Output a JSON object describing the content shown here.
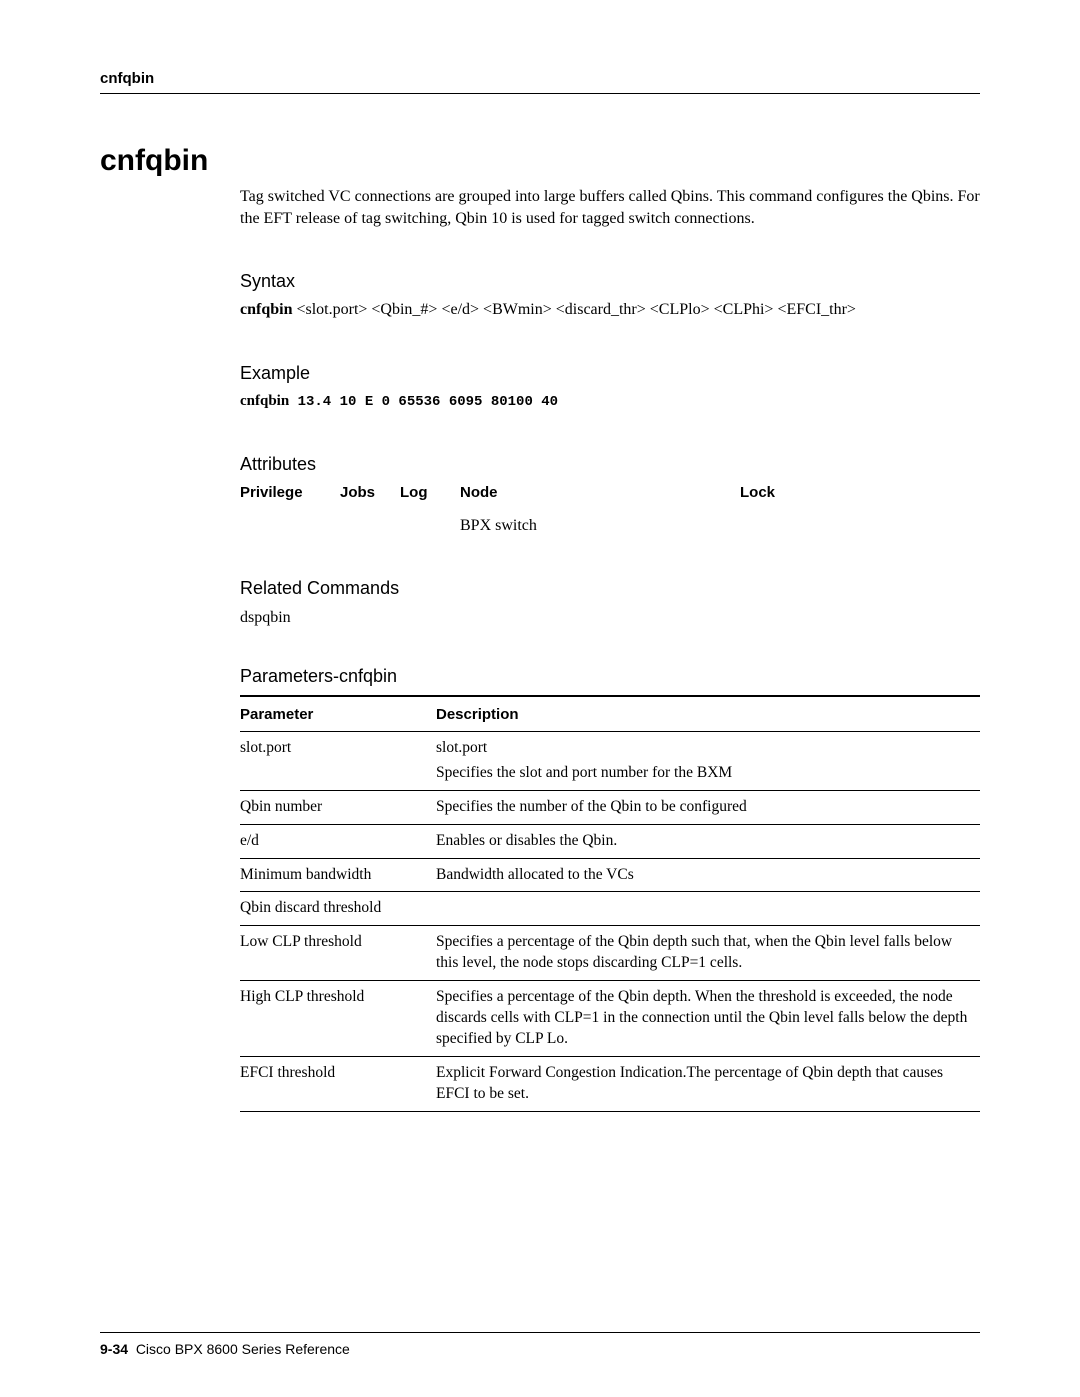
{
  "running_head": "cnfqbin",
  "title": "cnfqbin",
  "intro": "Tag switched VC connections are grouped into large buffers called Qbins. This command configures the Qbins. For the EFT release of tag switching, Qbin 10 is used for tagged switch connections.",
  "syntax": {
    "heading": "Syntax",
    "cmd": "cnfqbin",
    "args": " <slot.port> <Qbin_#> <e/d> <BWmin> <discard_thr> <CLPlo> <CLPhi> <EFCI_thr>"
  },
  "example": {
    "heading": "Example",
    "cmd": "cnfqbin",
    "args": " 13.4 10 E 0 65536 6095 80100 40"
  },
  "attributes": {
    "heading": "Attributes",
    "headers": {
      "privilege": "Privilege",
      "jobs": "Jobs",
      "log": "Log",
      "node": "Node",
      "lock": "Lock"
    },
    "values": {
      "privilege": "",
      "jobs": "",
      "log": "",
      "node": "BPX switch",
      "lock": ""
    }
  },
  "related": {
    "heading": "Related Commands",
    "text": "dspqbin"
  },
  "parameters": {
    "heading": "Parameters-cnfqbin",
    "col_param": "Parameter",
    "col_desc": "Description",
    "rows": [
      {
        "param": "slot.port",
        "desc": "slot.port\nSpecifies the slot and port number for the BXM"
      },
      {
        "param": "Qbin number",
        "desc": "Specifies the number of the Qbin to be configured"
      },
      {
        "param": "e/d",
        "desc": "Enables or disables the Qbin."
      },
      {
        "param": "Minimum bandwidth",
        "desc": "Bandwidth allocated to the VCs"
      },
      {
        "param": "Qbin discard threshold",
        "desc": ""
      },
      {
        "param": "Low CLP threshold",
        "desc": "Specifies a percentage of the Qbin depth such that, when the Qbin level falls below this level, the node stops discarding CLP=1 cells."
      },
      {
        "param": "High CLP threshold",
        "desc": "Specifies a percentage of the Qbin depth. When the threshold is exceeded, the node discards cells with CLP=1 in the connection until the Qbin level falls below the depth specified by CLP Lo."
      },
      {
        "param": "EFCI threshold",
        "desc": "Explicit Forward Congestion Indication.The percentage of Qbin depth that causes EFCI to be set."
      }
    ]
  },
  "footer": {
    "page": "9-34",
    "book": "Cisco BPX 8600 Series Reference"
  }
}
